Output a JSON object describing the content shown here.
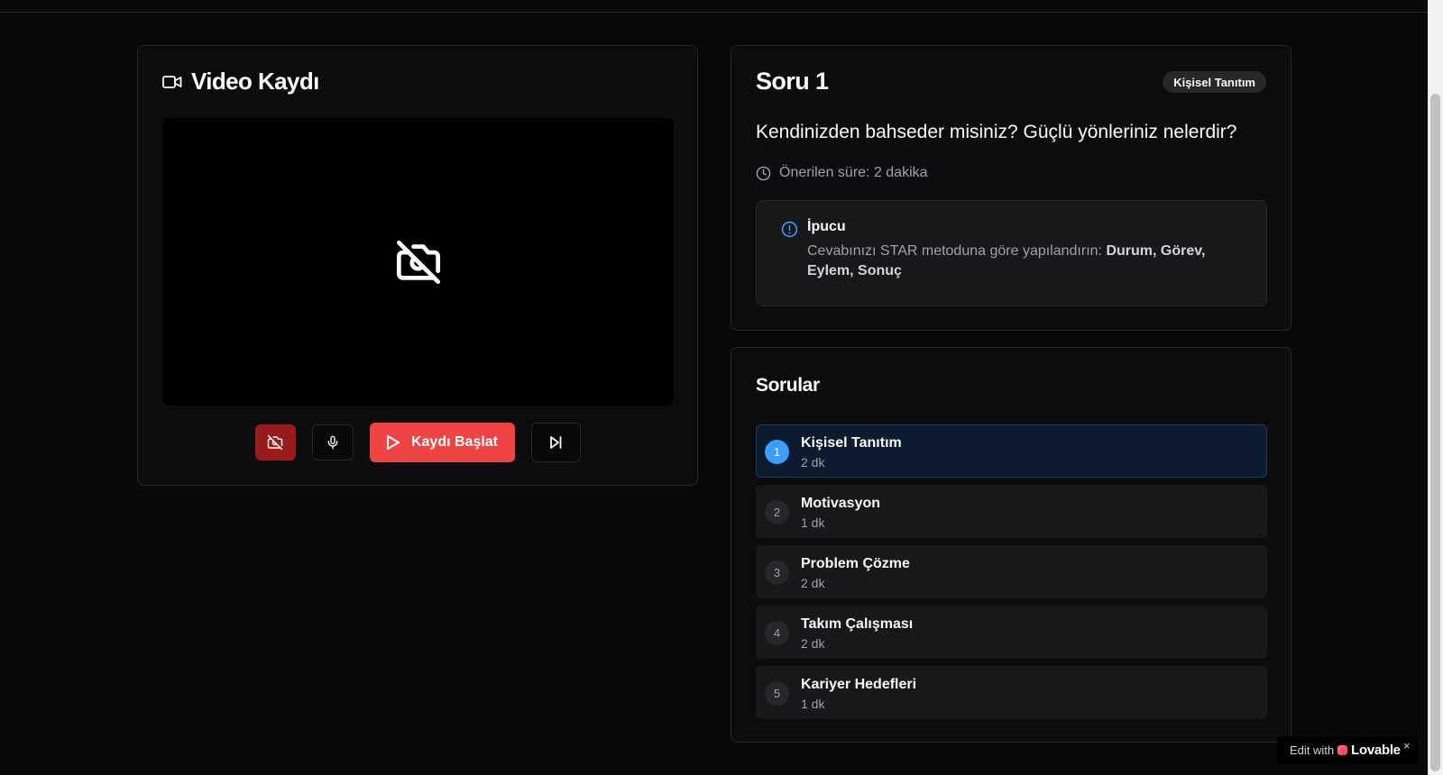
{
  "video_card": {
    "title": "Video Kaydı",
    "buttons": {
      "record_label": "Kaydı Başlat"
    }
  },
  "question": {
    "title": "Soru 1",
    "category_badge": "Kişisel Tanıtım",
    "text": "Kendinizden bahseder misiniz? Güçlü yönleriniz nelerdir?",
    "duration": "Önerilen süre: 2 dakika",
    "tip": {
      "title": "İpucu",
      "body_prefix": "Cevabınızı STAR metoduna göre yapılandırın: ",
      "body_bold": "Durum, Görev, Eylem, Sonuç"
    }
  },
  "questions_list": {
    "title": "Sorular",
    "items": [
      {
        "number": "1",
        "name": "Kişisel Tanıtım",
        "duration": "2 dk",
        "active": true
      },
      {
        "number": "2",
        "name": "Motivasyon",
        "duration": "1 dk",
        "active": false
      },
      {
        "number": "3",
        "name": "Problem Çözme",
        "duration": "2 dk",
        "active": false
      },
      {
        "number": "4",
        "name": "Takım Çalışması",
        "duration": "2 dk",
        "active": false
      },
      {
        "number": "5",
        "name": "Kariyer Hedefleri",
        "duration": "1 dk",
        "active": false
      }
    ]
  },
  "lovable_badge": {
    "prefix": "Edit with",
    "brand": "Lovable",
    "close": "×"
  },
  "colors": {
    "record_red": "#ef4444",
    "camera_off_red": "#991b1b",
    "active_blue": "#3b9eff",
    "tip_icon_blue": "#3b9eff"
  },
  "icons": {
    "video_title": "video-camera-icon",
    "video_placeholder": "camera-off-icon",
    "camera_toggle": "camera-off-icon",
    "mic": "microphone-icon",
    "record": "play-icon",
    "skip": "skip-forward-icon",
    "duration": "clock-icon",
    "tip": "alert-circle-icon"
  }
}
